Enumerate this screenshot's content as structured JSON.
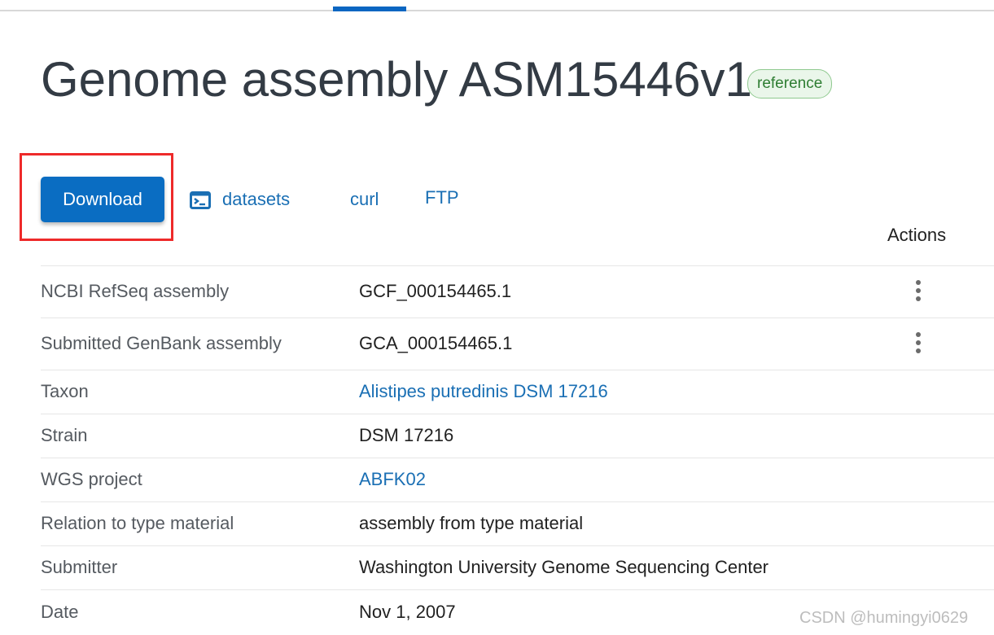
{
  "header": {
    "title": "Genome assembly ASM15446v1",
    "badge": "reference"
  },
  "actions": {
    "download_label": "Download",
    "datasets_label": "datasets",
    "datasets_icon": "terminal-icon",
    "curl_label": "curl",
    "ftp_label": "FTP",
    "actions_header": "Actions",
    "highlight_color": "#ee2a2a",
    "accent_color": "#0a6dc2"
  },
  "details": [
    {
      "label": "NCBI RefSeq assembly",
      "value": "GCF_000154465.1",
      "link": false,
      "menu": true
    },
    {
      "label": "Submitted GenBank assembly",
      "value": "GCA_000154465.1",
      "link": false,
      "menu": true
    },
    {
      "label": "Taxon",
      "value": "Alistipes putredinis DSM 17216",
      "link": true,
      "menu": false
    },
    {
      "label": "Strain",
      "value": "DSM 17216",
      "link": false,
      "menu": false
    },
    {
      "label": "WGS project",
      "value": "ABFK02",
      "link": true,
      "menu": false
    },
    {
      "label": "Relation to type material",
      "value": "assembly from type material",
      "link": false,
      "menu": false
    },
    {
      "label": "Submitter",
      "value": "Washington University Genome Sequencing Center",
      "link": false,
      "menu": false
    },
    {
      "label": "Date",
      "value": "Nov 1, 2007",
      "link": false,
      "menu": false
    }
  ],
  "watermark": "CSDN @humingyi0629"
}
